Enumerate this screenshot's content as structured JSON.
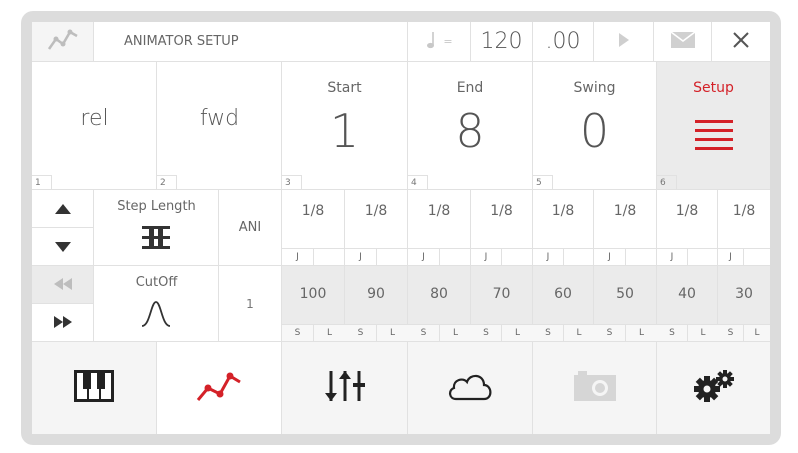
{
  "header": {
    "title": "ANIMATOR SETUP",
    "tempo_icon": "quarter-note-icon",
    "tempo_equals": "=",
    "bpm": "120",
    "fraction": ".00",
    "icons": [
      "graph-icon",
      "quarter-note-icon",
      "play-icon",
      "mail-icon",
      "close-icon"
    ]
  },
  "params": [
    {
      "num": "1",
      "value": "rel"
    },
    {
      "num": "2",
      "value": "fwd"
    },
    {
      "num": "3",
      "label": "Start",
      "value": "1"
    },
    {
      "num": "4",
      "label": "End",
      "value": "8"
    },
    {
      "num": "5",
      "label": "Swing",
      "value": "0"
    },
    {
      "num": "6",
      "label": "Setup"
    }
  ],
  "step_length": {
    "label": "Step Length",
    "mode": "ANI",
    "steps": [
      {
        "value": "1/8",
        "flag": "J"
      },
      {
        "value": "1/8",
        "flag": "J"
      },
      {
        "value": "1/8",
        "flag": "J"
      },
      {
        "value": "1/8",
        "flag": "J"
      },
      {
        "value": "1/8",
        "flag": "J"
      },
      {
        "value": "1/8",
        "flag": "J"
      },
      {
        "value": "1/8",
        "flag": "J"
      },
      {
        "value": "1/8",
        "flag": "J"
      }
    ]
  },
  "cutoff": {
    "label": "CutOff",
    "index": "1",
    "values": [
      {
        "value": "100",
        "s": "S",
        "l": "L"
      },
      {
        "value": "90",
        "s": "S",
        "l": "L"
      },
      {
        "value": "80",
        "s": "S",
        "l": "L"
      },
      {
        "value": "70",
        "s": "S",
        "l": "L"
      },
      {
        "value": "60",
        "s": "S",
        "l": "L"
      },
      {
        "value": "50",
        "s": "S",
        "l": "L"
      },
      {
        "value": "40",
        "s": "S",
        "l": "L"
      },
      {
        "value": "30",
        "s": "S",
        "l": "L"
      }
    ]
  },
  "nav_icons": [
    "up-arrow-icon",
    "down-arrow-icon",
    "rewind-icon",
    "fast-forward-icon"
  ],
  "bottom_tabs": [
    "piano-keys-icon",
    "graph-icon",
    "mixer-icon",
    "cloud-icon",
    "camera-icon",
    "gears-icon"
  ],
  "colors": {
    "accent": "#d42128",
    "text": "#555555",
    "grey_bg": "#ebebeb"
  }
}
